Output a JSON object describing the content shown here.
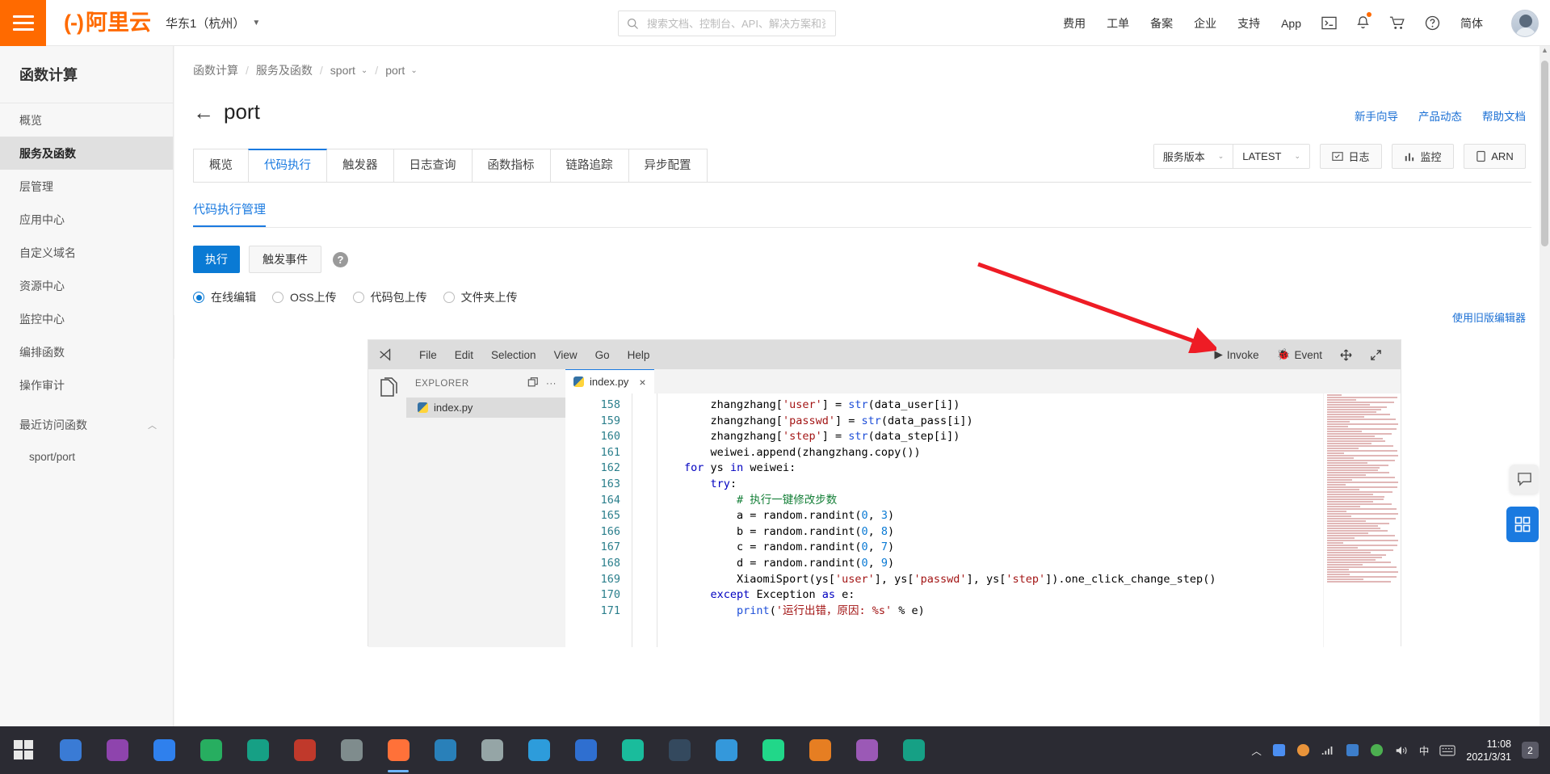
{
  "topbar": {
    "menu_icon": "hamburger-icon",
    "brand_name": "阿里云",
    "region": "华东1（杭州）",
    "search_placeholder": "搜索文档、控制台、API、解决方案和资源",
    "search_value": "",
    "nav_items": [
      {
        "label": "费用",
        "name": "nav-billing"
      },
      {
        "label": "工单",
        "name": "nav-tickets"
      },
      {
        "label": "备案",
        "name": "nav-icp"
      },
      {
        "label": "企业",
        "name": "nav-enterprise"
      },
      {
        "label": "支持",
        "name": "nav-support"
      },
      {
        "label": "App",
        "name": "nav-app"
      }
    ],
    "lang": "简体",
    "icons": [
      "terminal-icon",
      "bell-icon",
      "cart-icon",
      "help-icon"
    ]
  },
  "sidebar": {
    "title": "函数计算",
    "items": [
      {
        "label": "概览",
        "name": "sidebar-item-overview",
        "active": false
      },
      {
        "label": "服务及函数",
        "name": "sidebar-item-services-functions",
        "active": true
      },
      {
        "label": "层管理",
        "name": "sidebar-item-layers",
        "active": false
      },
      {
        "label": "应用中心",
        "name": "sidebar-item-app-center",
        "active": false
      },
      {
        "label": "自定义域名",
        "name": "sidebar-item-custom-domain",
        "active": false
      },
      {
        "label": "资源中心",
        "name": "sidebar-item-resource-center",
        "active": false
      },
      {
        "label": "监控中心",
        "name": "sidebar-item-monitor-center",
        "active": false
      },
      {
        "label": "编排函数",
        "name": "sidebar-item-orchestration",
        "active": false
      },
      {
        "label": "操作审计",
        "name": "sidebar-item-audit",
        "active": false
      }
    ],
    "recent_group_label": "最近访问函数",
    "recent_items": [
      {
        "label": "sport/port"
      }
    ]
  },
  "breadcrumb": {
    "items": [
      {
        "label": "函数计算",
        "chevron": false
      },
      {
        "label": "服务及函数",
        "chevron": false
      },
      {
        "label": "sport",
        "chevron": true
      },
      {
        "label": "port",
        "chevron": true
      }
    ]
  },
  "header_links": [
    {
      "label": "新手向导",
      "name": "link-beginner-guide"
    },
    {
      "label": "产品动态",
      "name": "link-product-news"
    },
    {
      "label": "帮助文档",
      "name": "link-help-docs"
    }
  ],
  "page": {
    "title": "port",
    "back_icon": "back-arrow-icon"
  },
  "head_actions": {
    "version_select": "服务版本",
    "alias_select": "LATEST",
    "buttons": [
      {
        "label": "日志",
        "icon": "log-icon",
        "name": "logs-button"
      },
      {
        "label": "监控",
        "icon": "chart-icon",
        "name": "monitor-button"
      },
      {
        "label": "ARN",
        "icon": "copy-icon",
        "name": "arn-button"
      }
    ]
  },
  "tabs": [
    {
      "label": "概览",
      "name": "tab-overview",
      "active": false
    },
    {
      "label": "代码执行",
      "name": "tab-code-execution",
      "active": true
    },
    {
      "label": "触发器",
      "name": "tab-triggers",
      "active": false
    },
    {
      "label": "日志查询",
      "name": "tab-log-query",
      "active": false
    },
    {
      "label": "函数指标",
      "name": "tab-function-metrics",
      "active": false
    },
    {
      "label": "链路追踪",
      "name": "tab-tracing",
      "active": false
    },
    {
      "label": "异步配置",
      "name": "tab-async-config",
      "active": false
    }
  ],
  "subtab": {
    "label": "代码执行管理"
  },
  "actions": {
    "run_label": "执行",
    "event_label": "触发事件",
    "help_label": "?"
  },
  "upload_modes": [
    {
      "label": "在线编辑",
      "selected": true,
      "name": "radio-online-edit"
    },
    {
      "label": "OSS上传",
      "selected": false,
      "name": "radio-oss-upload"
    },
    {
      "label": "代码包上传",
      "selected": false,
      "name": "radio-zip-upload"
    },
    {
      "label": "文件夹上传",
      "selected": false,
      "name": "radio-folder-upload"
    }
  ],
  "old_editor_link": "使用旧版编辑器",
  "editor": {
    "menus": [
      "File",
      "Edit",
      "Selection",
      "View",
      "Go",
      "Help"
    ],
    "right_actions": [
      {
        "label": "Invoke",
        "icon": "play-icon",
        "name": "editor-invoke-button"
      },
      {
        "label": "Event",
        "icon": "bug-icon",
        "name": "editor-event-button"
      },
      {
        "label": "",
        "icon": "move-icon",
        "name": "editor-move-button"
      },
      {
        "label": "",
        "icon": "expand-icon",
        "name": "editor-expand-button"
      }
    ],
    "explorer_title": "EXPLORER",
    "explorer_files": [
      {
        "label": "index.py",
        "icon": "python-file-icon"
      }
    ],
    "open_tab": {
      "label": "index.py",
      "icon": "python-file-icon",
      "close": "×"
    },
    "first_line_number": 158,
    "lines": [
      {
        "n": 158,
        "html": "            zhangzhang[<span class='str'>'user'</span>] = <span class='fn'>str</span>(data_user[i])"
      },
      {
        "n": 159,
        "html": "            zhangzhang[<span class='str'>'passwd'</span>] = <span class='fn'>str</span>(data_pass[i])"
      },
      {
        "n": 160,
        "html": "            zhangzhang[<span class='str'>'step'</span>] = <span class='fn'>str</span>(data_step[i])"
      },
      {
        "n": 161,
        "html": "            weiwei.append(zhangzhang.copy())"
      },
      {
        "n": 162,
        "html": "        <span class='kw'>for</span> ys <span class='kw'>in</span> weiwei:"
      },
      {
        "n": 163,
        "html": "            <span class='kw'>try</span>:"
      },
      {
        "n": 164,
        "html": "                <span class='cmt'># 执行一键修改步数</span>"
      },
      {
        "n": 165,
        "html": "                a = random.randint(<span class='num'>0</span>, <span class='num'>3</span>)"
      },
      {
        "n": 166,
        "html": "                b = random.randint(<span class='num'>0</span>, <span class='num'>8</span>)"
      },
      {
        "n": 167,
        "html": "                c = random.randint(<span class='num'>0</span>, <span class='num'>7</span>)"
      },
      {
        "n": 168,
        "html": "                d = random.randint(<span class='num'>0</span>, <span class='num'>9</span>)"
      },
      {
        "n": 169,
        "html": "                XiaomiSport(ys[<span class='str'>'user'</span>], ys[<span class='str'>'passwd'</span>], ys[<span class='str'>'step'</span>]).one_click_change_step()"
      },
      {
        "n": 170,
        "html": "            <span class='kw'>except</span> Exception <span class='kw'>as</span> e:"
      },
      {
        "n": 171,
        "html": "                <span class='fn'>print</span>(<span class='str'>'运行出错，原因: %s'</span> % e)"
      }
    ]
  },
  "annotation": {
    "arrow_color": "#ee1c25"
  },
  "float_buttons": [
    {
      "name": "chat-button",
      "icon": "chat-icon"
    },
    {
      "name": "apps-button",
      "icon": "grid-icon"
    }
  ],
  "taskbar": {
    "start_icon": "windows-icon",
    "apps": [
      {
        "name": "taskbar-app-1",
        "color": "#3a7bd5",
        "active": false
      },
      {
        "name": "taskbar-app-2",
        "color": "#8e44ad",
        "active": false
      },
      {
        "name": "taskbar-app-3",
        "color": "#2f80ed",
        "active": false
      },
      {
        "name": "taskbar-app-4",
        "color": "#27ae60",
        "active": false
      },
      {
        "name": "taskbar-app-5",
        "color": "#16a085",
        "active": false
      },
      {
        "name": "taskbar-app-6",
        "color": "#c0392b",
        "active": false
      },
      {
        "name": "taskbar-app-7",
        "color": "#7f8c8d",
        "active": false
      },
      {
        "name": "taskbar-app-firefox",
        "color": "#ff7139",
        "active": true
      },
      {
        "name": "taskbar-app-8",
        "color": "#2980b9",
        "active": false
      },
      {
        "name": "taskbar-app-9",
        "color": "#95a5a6",
        "active": false
      },
      {
        "name": "taskbar-app-10",
        "color": "#2d9cdb",
        "active": false
      },
      {
        "name": "taskbar-app-11",
        "color": "#2f6fd0",
        "active": false
      },
      {
        "name": "taskbar-app-12",
        "color": "#1abc9c",
        "active": false
      },
      {
        "name": "taskbar-app-13",
        "color": "#34495e",
        "active": false
      },
      {
        "name": "taskbar-app-14",
        "color": "#3498db",
        "active": false
      },
      {
        "name": "taskbar-app-pycharm",
        "color": "#21d789",
        "active": false
      },
      {
        "name": "taskbar-app-15",
        "color": "#e67e22",
        "active": false
      },
      {
        "name": "taskbar-app-16",
        "color": "#9b59b6",
        "active": false
      },
      {
        "name": "taskbar-app-17",
        "color": "#16a085",
        "active": false
      }
    ],
    "tray_lang": "中",
    "clock_time": "11:08",
    "clock_date": "2021/3/31",
    "notification_count": "2"
  }
}
